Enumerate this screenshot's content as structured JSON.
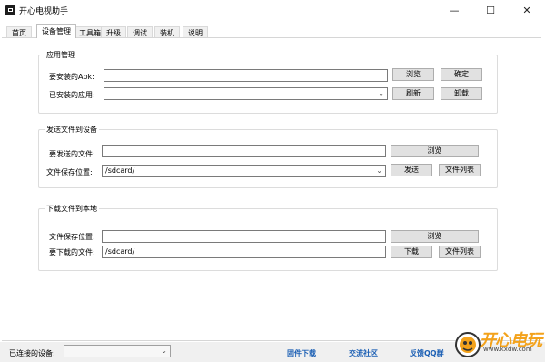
{
  "window": {
    "title": "开心电视助手",
    "minimize_glyph": "—",
    "maximize_glyph": "☐",
    "close_glyph": "✕"
  },
  "tabs": [
    "首页",
    "设备管理",
    "工具箱",
    "升级",
    "调试",
    "装机",
    "说明"
  ],
  "active_tab": "设备管理",
  "app_mgmt": {
    "title": "应用管理",
    "apk_label": "要安装的Apk:",
    "apk_value": "",
    "browse": "浏览",
    "confirm": "确定",
    "installed_label": "已安装的应用:",
    "installed_value": "",
    "refresh": "刷新",
    "uninstall": "卸载"
  },
  "send_files": {
    "title": "发送文件到设备",
    "file_label": "要发送的文件:",
    "file_value": "",
    "browse": "浏览",
    "save_label": "文件保存位置:",
    "save_value": "/sdcard/",
    "send": "发送",
    "file_list": "文件列表"
  },
  "download_files": {
    "title": "下载文件到本地",
    "save_label": "文件保存位置:",
    "save_value": "",
    "browse": "浏览",
    "download_label": "要下载的文件:",
    "download_value": "/sdcard/",
    "download": "下载",
    "file_list": "文件列表"
  },
  "status": {
    "connected_label": "已连接的设备:",
    "connected_value": "",
    "links": [
      "固件下载",
      "交流社区",
      "反馈QQ群"
    ]
  },
  "logo": {
    "text": "开心电玩",
    "sub": "www.kxdw.com"
  },
  "icons": {
    "dropdown": "chevron-down-icon",
    "app": "app-icon"
  }
}
